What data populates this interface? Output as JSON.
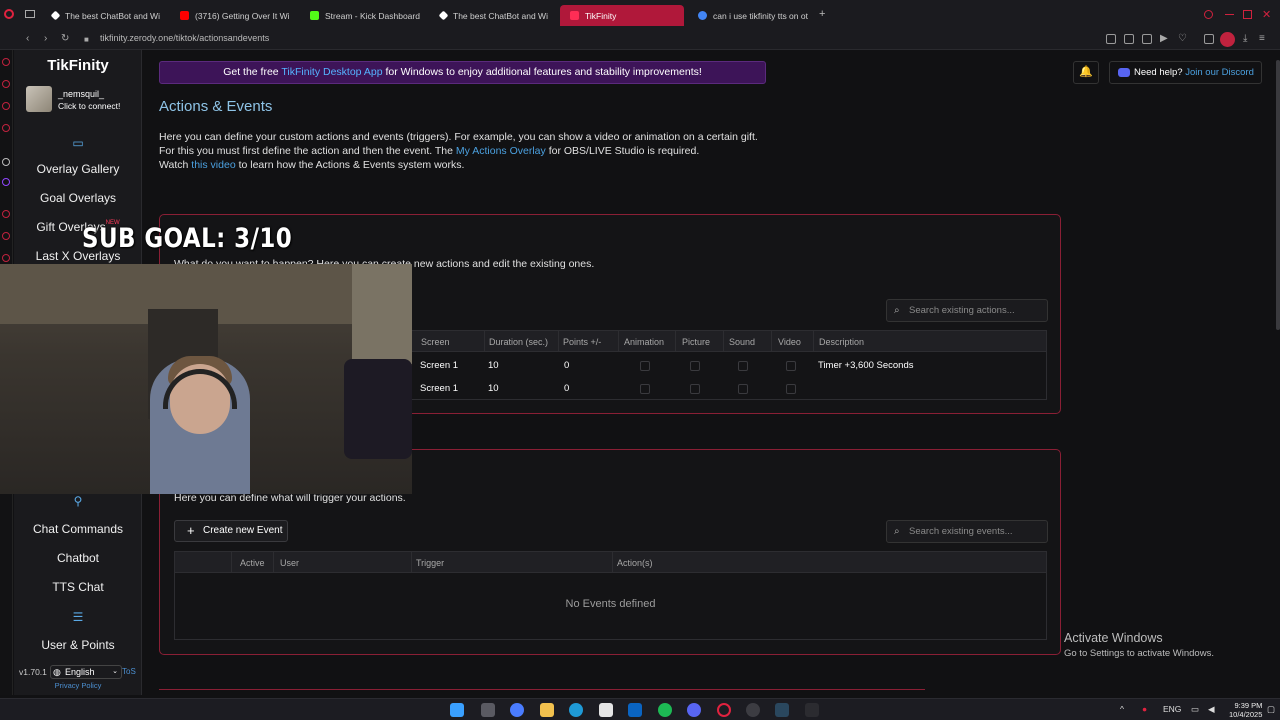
{
  "browser": {
    "tabs": [
      {
        "label": "The best ChatBot and Wi",
        "color": "#ffffff"
      },
      {
        "label": "(3716) Getting Over It Wi",
        "color": "#ff0000"
      },
      {
        "label": "Stream - Kick Dashboard",
        "color": "#53fc18"
      },
      {
        "label": "The best ChatBot and Wi",
        "color": "#ffffff"
      },
      {
        "label": "TikFinity",
        "color": "#ff2d55"
      },
      {
        "label": "can i use tikfinity tts on ot",
        "color": "#4285f4"
      }
    ],
    "new_tab": "+",
    "url": "tikfinity.zerody.one/tiktok/actionsandevents"
  },
  "sidebar": {
    "brand": "TikFinity",
    "username": "_nemsquil_",
    "connect": "Click to connect!",
    "items_top": [
      "Overlay Gallery",
      "Goal Overlays",
      "Gift Overlays",
      "Last X Overlays"
    ],
    "new_badge": "NEW",
    "items_bottom": [
      "Chat Commands",
      "Chatbot",
      "TTS Chat",
      "User & Points"
    ],
    "version": "v1.70.1",
    "language": "English",
    "tos": "ToS",
    "privacy": "Privacy Policy"
  },
  "banner": {
    "pre": "Get the free ",
    "link": "TikFinity Desktop App",
    "post": " for Windows to enjoy additional features and stability improvements!"
  },
  "header": {
    "help_pre": "Need help? ",
    "help_link": "Join our Discord"
  },
  "page": {
    "title": "Actions & Events",
    "intro_line1": "Here you can define your custom actions and events (triggers). For example, you can show a video or animation on a certain gift.",
    "intro_line2_pre": "For this you must first define the action and then the event. The ",
    "intro_line2_link": "My Actions Overlay",
    "intro_line2_post": " for OBS/LIVE Studio is required.",
    "intro_line3_pre": "Watch ",
    "intro_line3_link": "this video",
    "intro_line3_post": " to learn how the Actions & Events system works."
  },
  "actions": {
    "description": "What do you want to happen? Here you can create new actions and edit the existing ones.",
    "search_placeholder": "Search existing actions...",
    "columns": [
      "Screen",
      "Duration (sec.)",
      "Points +/-",
      "Animation",
      "Picture",
      "Sound",
      "Video",
      "Description"
    ],
    "rows": [
      {
        "screen": "Screen 1",
        "duration": "10",
        "points": "0",
        "description": "Timer +3,600 Seconds"
      },
      {
        "screen": "Screen 1",
        "duration": "10",
        "points": "0",
        "description": ""
      }
    ]
  },
  "events": {
    "description": "Here you can define what will trigger your actions.",
    "create_label": "Create new Event",
    "search_placeholder": "Search existing events...",
    "columns": [
      "Active",
      "User",
      "Trigger",
      "Action(s)"
    ],
    "empty": "No Events defined"
  },
  "overlay": {
    "subgoal": "SUB GOAL: 3/10"
  },
  "windows": {
    "activate_title": "Activate Windows",
    "activate_sub": "Go to Settings to activate Windows.",
    "lang": "ENG",
    "time": "9:39 PM",
    "date": "10/4/2025"
  },
  "colors": {
    "accent": "#b0183a",
    "link": "#4ba0df",
    "banner": "#3d1458"
  }
}
